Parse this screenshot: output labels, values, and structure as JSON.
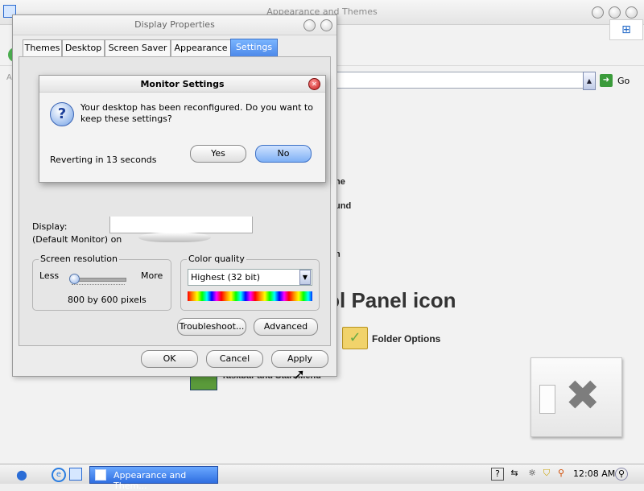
{
  "background_window": {
    "title": "Appearance and Themes",
    "address_go_label": "Go",
    "task_fragments": [
      "ne",
      "und",
      "n"
    ],
    "heading_fragment": "rol Panel icon",
    "folder_options_label": "Folder Options",
    "taskbar_start_menu_label": "Taskbar and Start Menu"
  },
  "display_properties": {
    "title": "Display Properties",
    "tabs": [
      {
        "label": "Themes"
      },
      {
        "label": "Desktop"
      },
      {
        "label": "Screen Saver"
      },
      {
        "label": "Appearance"
      },
      {
        "label": "Settings",
        "active": true
      }
    ],
    "display_label": "Display:",
    "display_value": "(Default Monitor) on",
    "screen_resolution": {
      "title": "Screen resolution",
      "less_label": "Less",
      "more_label": "More",
      "value_text": "800 by 600 pixels",
      "slider_position": 0
    },
    "color_quality": {
      "title": "Color quality",
      "selected": "Highest (32 bit)"
    },
    "troubleshoot_label": "Troubleshoot...",
    "advanced_label": "Advanced",
    "ok_label": "OK",
    "cancel_label": "Cancel",
    "apply_label": "Apply"
  },
  "monitor_settings": {
    "title": "Monitor Settings",
    "message": "Your desktop has been reconfigured.  Do you want to keep these settings?",
    "countdown": "Reverting in 13 seconds",
    "yes_label": "Yes",
    "no_label": "No"
  },
  "taskbar": {
    "active_task_label": "Appearance and Them...",
    "clock": "12:08 AM"
  },
  "colors": {
    "accent": "#4a86e8",
    "default_button": "#7fb0f5"
  }
}
